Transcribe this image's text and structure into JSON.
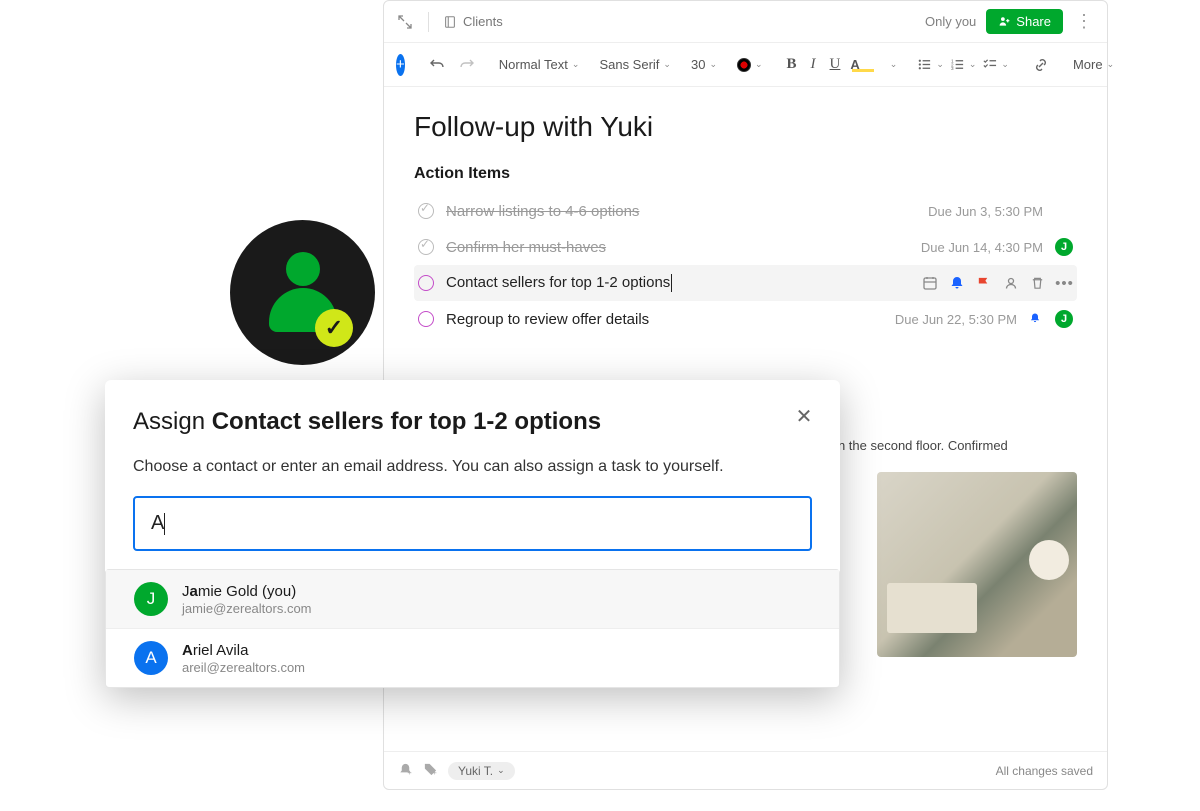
{
  "topbar": {
    "breadcrumb": "Clients",
    "visibility": "Only you",
    "share_label": "Share"
  },
  "toolbar": {
    "style": "Normal Text",
    "font": "Sans Serif",
    "size": "30",
    "more_label": "More"
  },
  "doc": {
    "title": "Follow-up with Yuki",
    "section": "Action Items",
    "tasks": [
      {
        "text": "Narrow listings to 4-6 options",
        "done": true,
        "due": "Due Jun 3, 5:30 PM"
      },
      {
        "text": "Confirm her must-haves",
        "done": true,
        "due": "Due Jun 14, 4:30 PM",
        "avatar": "J"
      },
      {
        "text": "Contact sellers for top 1-2 options",
        "done": false,
        "active": true
      },
      {
        "text": "Regroup to review offer details",
        "done": false,
        "due": "Due Jun 22, 5:30 PM",
        "avatar": "J"
      }
    ],
    "note_fragment": "in on the second floor. Confirmed"
  },
  "footer": {
    "tag": "Yuki T.",
    "status": "All changes saved"
  },
  "modal": {
    "title_prefix": "Assign ",
    "title_bold": "Contact sellers for top 1-2 options",
    "description": "Choose a contact or enter an email address. You can also assign a task to yourself.",
    "input_value": "A",
    "suggestions": [
      {
        "initial": "J",
        "color": "green",
        "name_pre": "J",
        "name_hl": "a",
        "name_post": "mie Gold (you)",
        "email": "jamie@zerealtors.com"
      },
      {
        "initial": "A",
        "color": "blue",
        "name_pre": "",
        "name_hl": "A",
        "name_post": "riel Avila",
        "email": "areil@zerealtors.com"
      }
    ]
  }
}
